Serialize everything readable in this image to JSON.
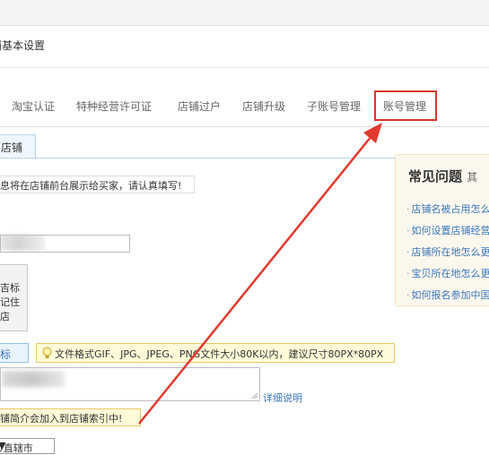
{
  "breadcrumb": {
    "title": "铺基本设置"
  },
  "tabs": [
    "淘宝认证",
    "特种经营许可证",
    "店铺过户",
    "店铺升级",
    "子账号管理",
    "账号管理"
  ],
  "store_tab": {
    "label": "店铺"
  },
  "notice": {
    "text": "息将在店铺前台展示给买家，请认真填写!"
  },
  "logo_box": {
    "lines": [
      "吉标",
      "记住",
      "店"
    ]
  },
  "logo_button": {
    "label": "标"
  },
  "tip": {
    "text": "文件格式GIF、JPG、JPEG、PNG文件大小80K以内，建议尺寸80PX*80PX"
  },
  "detail_link": {
    "text": "详细说明"
  },
  "index_tip": {
    "text": "铺简介会加入到店铺索引中!"
  },
  "select": {
    "value": "/直辖市"
  },
  "faq": {
    "title": "常见问题",
    "more": "其",
    "items": [
      "店铺名被占用怎么",
      "如何设置店铺经营",
      "店铺所在地怎么更",
      "宝贝所在地怎么更",
      "如何报名参加中国"
    ]
  },
  "colors": {
    "highlight": "#d8362b",
    "link": "#3a76b8",
    "tip_bg": "#fffbd8"
  }
}
